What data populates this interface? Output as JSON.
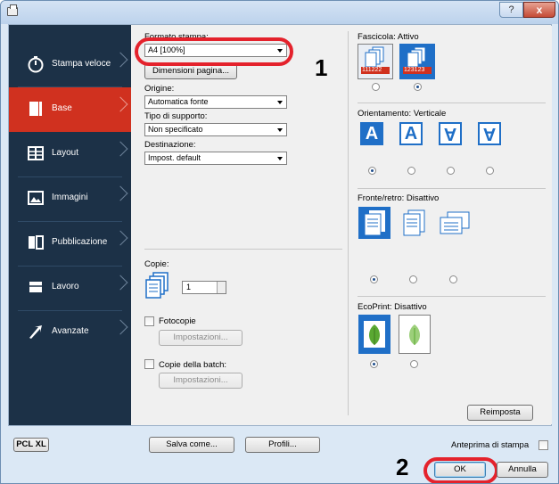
{
  "window": {
    "help_glyph": "?",
    "close_glyph": "x"
  },
  "sidebar": {
    "items": [
      {
        "label": "Stampa veloce",
        "icon": "stopwatch-icon"
      },
      {
        "label": "Base",
        "icon": "base-icon"
      },
      {
        "label": "Layout",
        "icon": "layout-icon"
      },
      {
        "label": "Immagini",
        "icon": "image-icon"
      },
      {
        "label": "Pubblicazione",
        "icon": "publication-icon"
      },
      {
        "label": "Lavoro",
        "icon": "job-tray-icon"
      },
      {
        "label": "Avanzate",
        "icon": "arrow-icon"
      }
    ],
    "active": "Base"
  },
  "left_panel": {
    "formato_label": "Formato stampa:",
    "formato_value": "A4  [100%]",
    "dimensioni_button": "Dimensioni pagina...",
    "origine_label": "Origine:",
    "origine_value": "Automatica fonte",
    "tipo_label": "Tipo di supporto:",
    "tipo_value": "Non specificato",
    "destinazione_label": "Destinazione:",
    "destinazione_value": "Impost. default",
    "copie_label": "Copie:",
    "copie_value": "1",
    "fotocopie_label": "Fotocopie",
    "fotocopie_settings": "Impostazioni...",
    "batch_label": "Copie della batch:",
    "batch_settings": "Impostazioni..."
  },
  "right_panel": {
    "fascicola": "Fascicola:  Attivo",
    "fascicola_off_nums": "111222",
    "fascicola_on_nums": "123123",
    "orientamento": "Orientamento:  Verticale",
    "orient_glyphs": [
      "A",
      "A",
      "A",
      "A"
    ],
    "fronte_retro": "Fronte/retro:  Disattivo",
    "ecoprint": "EcoPrint:  Disattivo",
    "reimposta": "Reimposta"
  },
  "bottom": {
    "pcl": "PCL XL",
    "salva": "Salva come...",
    "profili": "Profili...",
    "anteprima": "Anteprima di stampa",
    "ok": "OK",
    "annulla": "Annulla"
  },
  "callouts": {
    "one": "1",
    "two": "2"
  },
  "colors": {
    "sidebar": "#1c3147",
    "active": "#d0311f",
    "accent": "#1f6fc7",
    "callout": "#e4222c"
  }
}
